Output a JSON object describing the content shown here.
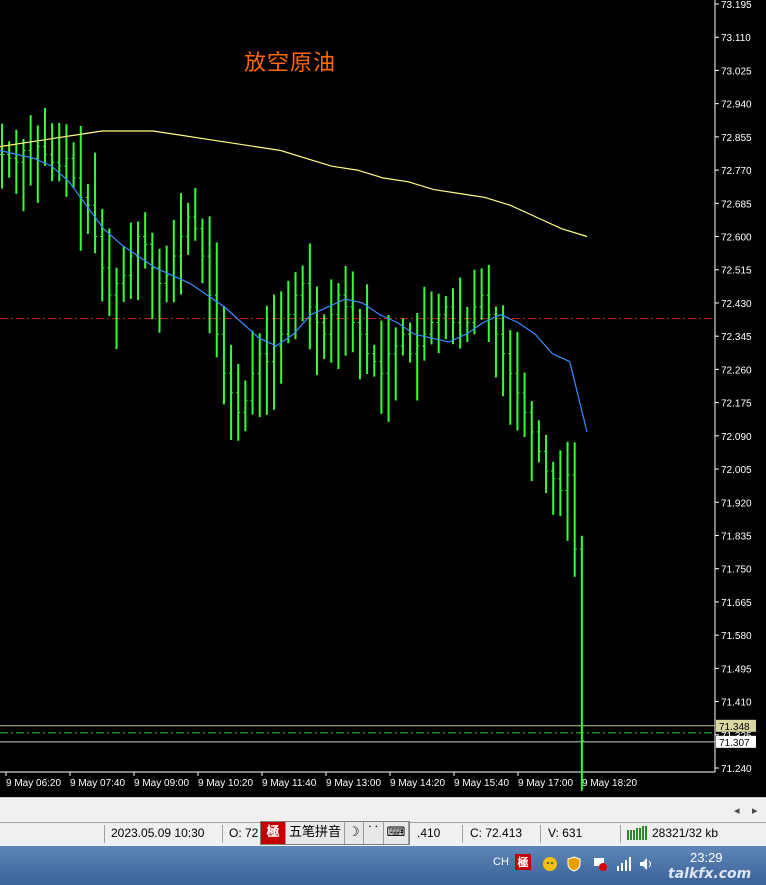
{
  "chart_title": "放空原油",
  "chart_data": {
    "type": "candlestick",
    "title": "放空原油",
    "yticks": [
      "73.195",
      "73.110",
      "73.025",
      "72.940",
      "72.855",
      "72.770",
      "72.685",
      "72.600",
      "72.515",
      "72.430",
      "72.345",
      "72.260",
      "72.175",
      "72.090",
      "72.005",
      "71.920",
      "71.835",
      "71.750",
      "71.665",
      "71.580",
      "71.495",
      "71.410",
      "71.325",
      "71.240"
    ],
    "ylim": [
      71.24,
      73.195
    ],
    "xticks": [
      "9 May 06:20",
      "9 May 07:40",
      "9 May 09:00",
      "9 May 10:20",
      "9 May 11:40",
      "9 May 13:00",
      "9 May 14:20",
      "9 May 15:40",
      "9 May 17:00",
      "9 May 18:20"
    ],
    "price_labels": [
      "71.348",
      "71.307"
    ],
    "close_series": [
      72.81,
      72.8,
      72.79,
      72.82,
      72.8,
      72.83,
      72.81,
      72.79,
      72.78,
      72.8,
      72.75,
      72.7,
      72.68,
      72.6,
      72.52,
      72.45,
      72.48,
      72.5,
      72.55,
      72.6,
      72.58,
      72.52,
      72.48,
      72.5,
      72.55,
      72.6,
      72.65,
      72.62,
      72.55,
      72.45,
      72.35,
      72.25,
      72.2,
      72.15,
      72.18,
      72.25,
      72.3,
      72.28,
      72.32,
      72.35,
      72.4,
      72.45,
      72.48,
      72.42,
      72.38,
      72.35,
      72.4,
      72.45,
      72.42,
      72.38,
      72.35,
      72.3,
      72.28,
      72.25,
      72.3,
      72.32,
      72.35,
      72.3,
      72.32,
      72.35,
      72.38,
      72.4,
      72.42,
      72.38,
      72.35,
      72.38,
      72.42,
      72.45,
      72.4,
      72.35,
      72.3,
      72.25,
      72.2,
      72.15,
      72.1,
      72.05,
      72.0,
      71.98,
      71.95,
      71.99,
      71.8,
      71.31
    ],
    "ma_slow": [
      72.83,
      72.84,
      72.85,
      72.86,
      72.87,
      72.87,
      72.87,
      72.86,
      72.85,
      72.84,
      72.83,
      72.82,
      72.8,
      72.78,
      72.77,
      72.75,
      72.74,
      72.72,
      72.71,
      72.7,
      72.68,
      72.65,
      72.62,
      72.6
    ],
    "ma_fast": [
      72.82,
      72.81,
      72.8,
      72.78,
      72.74,
      72.68,
      72.62,
      72.58,
      72.55,
      72.52,
      72.5,
      72.48,
      72.45,
      72.42,
      72.38,
      72.34,
      72.32,
      72.35,
      72.4,
      72.42,
      72.44,
      72.43,
      72.4,
      72.38,
      72.35,
      72.34,
      72.33,
      72.35,
      72.38,
      72.4,
      72.38,
      72.35,
      72.3,
      72.28,
      72.1
    ],
    "ref_levels": {
      "red_dashdot": 72.39,
      "green_dashdot": 71.33,
      "yellow_solid": 71.348,
      "white_solid": 71.307
    },
    "colors": {
      "bars": "#33ff33",
      "ma_slow": "#ffff80",
      "ma_fast": "#3a8cff",
      "level_red": "#cc2200"
    }
  },
  "scroll": {
    "left_arrow": "◂",
    "right_arrow": "▸"
  },
  "status": {
    "datetime": "2023.05.09 10:30",
    "open_prefix": "O: 72",
    "high_fragment": ".410",
    "close": "C: 72.413",
    "volume": "V: 631",
    "traffic": "28321/32 kb"
  },
  "ime": {
    "logo": "極",
    "mode": "五笔拼音",
    "moon": "☽",
    "punct": "˙˙",
    "keyboard": "⌨"
  },
  "taskbar": {
    "lang": "CH",
    "time": "23:29"
  },
  "watermark": "talkfx.com"
}
